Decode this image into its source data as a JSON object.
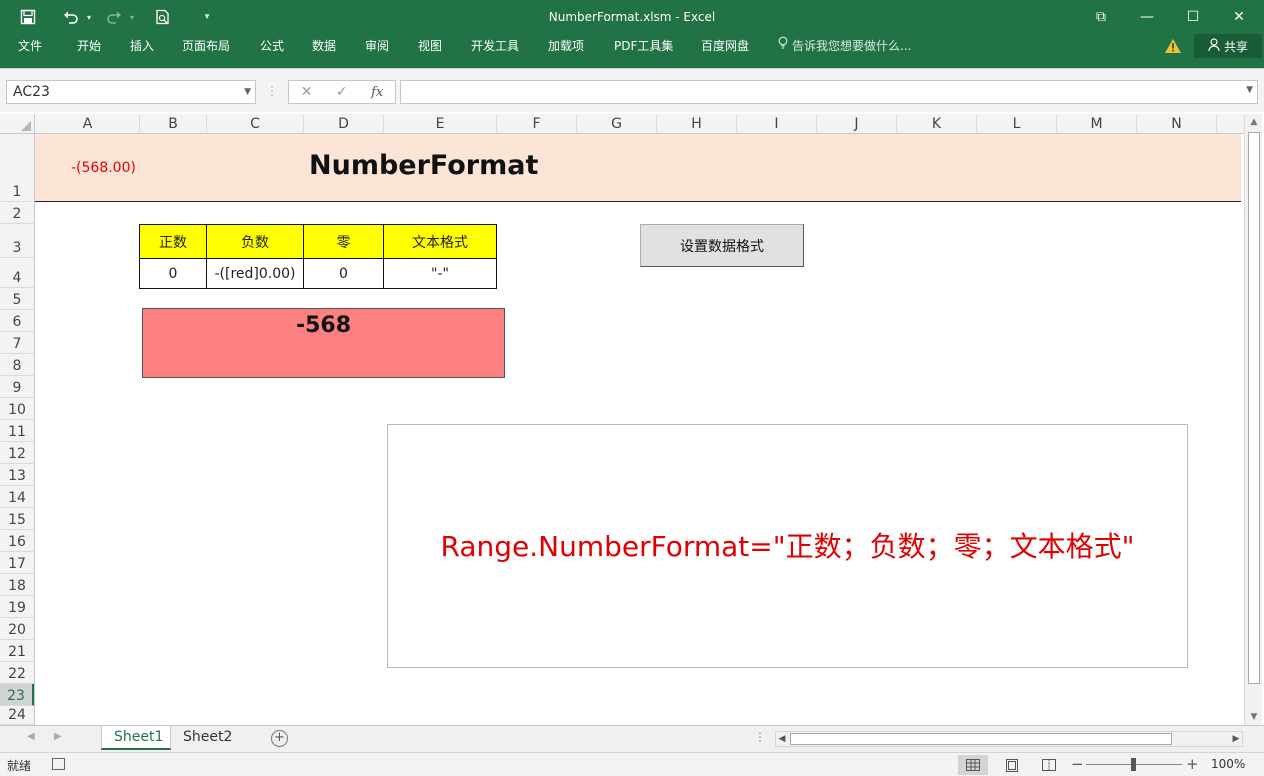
{
  "window": {
    "title": "NumberFormat.xlsm  -  Excel",
    "controls": {
      "ribbon_display": "⧉",
      "minimize": "—",
      "restore": "☐",
      "close": "✕"
    }
  },
  "quick_access": {
    "save_icon": "floppy-disk-icon",
    "undo_icon": "undo-icon",
    "redo_icon": "redo-icon",
    "preview_icon": "print-preview-icon",
    "customize_icon": "chevron-down-icon"
  },
  "ribbon": {
    "tabs": [
      "文件",
      "开始",
      "插入",
      "页面布局",
      "公式",
      "数据",
      "审阅",
      "视图",
      "开发工具",
      "加载项",
      "PDF工具集",
      "百度网盘"
    ],
    "tell_me": "告诉我您想要做什么...",
    "share": "共享"
  },
  "formula_bar": {
    "name_box": "AC23",
    "cancel": "✕",
    "enter": "✓",
    "fx": "fx",
    "formula": ""
  },
  "sheet": {
    "columns": [
      "A",
      "B",
      "C",
      "D",
      "E",
      "F",
      "G",
      "H",
      "I",
      "J",
      "K",
      "L",
      "M",
      "N"
    ],
    "rows": [
      "1",
      "2",
      "3",
      "4",
      "5",
      "6",
      "7",
      "8",
      "9",
      "10",
      "11",
      "12",
      "13",
      "14",
      "15",
      "16",
      "17",
      "18",
      "19",
      "20",
      "21",
      "22",
      "23",
      "24"
    ],
    "selected_row": "23",
    "a1_value": "-(568.00)",
    "title": "NumberFormat",
    "format_table": {
      "headers": [
        "正数",
        "负数",
        "零",
        "文本格式"
      ],
      "values": [
        "0",
        "-([red]0.00)",
        "0",
        "\"-\""
      ]
    },
    "result_box": "-568",
    "set_format_button": "设置数据格式",
    "note": "Range.NumberFormat=\"正数；负数；零；文本格式\"",
    "colors": {
      "title_band": "#fce4d6",
      "header_fill": "#ffff00",
      "result_fill": "#ff8080",
      "note_text": "#e00000"
    }
  },
  "sheet_tabs": {
    "tabs": [
      "Sheet1",
      "Sheet2"
    ],
    "active": "Sheet1",
    "add_icon": "plus-circle-icon"
  },
  "status_bar": {
    "ready": "就绪",
    "zoom": "100%"
  }
}
